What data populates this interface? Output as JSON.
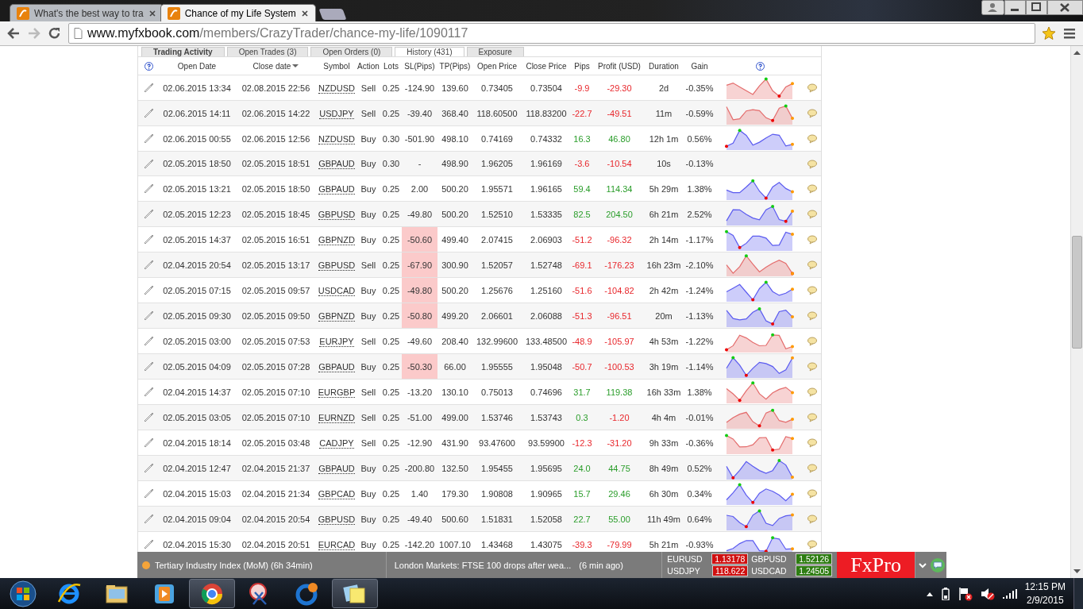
{
  "browser": {
    "tabs": [
      {
        "title": "What's the best way to tra",
        "selected": false
      },
      {
        "title": "Chance of my Life System",
        "selected": true
      }
    ],
    "url": {
      "host": "www.myfxbook.com",
      "path": "/members/CrazyTrader/chance-my-life/1090117"
    }
  },
  "page": {
    "tabs": [
      {
        "label": "Trading Activity",
        "selected": false
      },
      {
        "label": "Open Trades (3)",
        "selected": false
      },
      {
        "label": "Open Orders (0)",
        "selected": false
      },
      {
        "label": "History (431)",
        "selected": true
      },
      {
        "label": "Exposure",
        "selected": false
      }
    ],
    "columns": [
      {
        "label": "Open Date",
        "sorted": false
      },
      {
        "label": "Close date",
        "sorted": true
      },
      {
        "label": "Symbol",
        "sorted": false
      },
      {
        "label": "Action",
        "sorted": false
      },
      {
        "label": "Lots",
        "sorted": false
      },
      {
        "label": "SL(Pips)",
        "sorted": false
      },
      {
        "label": "TP(Pips)",
        "sorted": false
      },
      {
        "label": "Open Price",
        "sorted": false
      },
      {
        "label": "Close Price",
        "sorted": false
      },
      {
        "label": "Pips",
        "sorted": false
      },
      {
        "label": "Profit (USD)",
        "sorted": false
      },
      {
        "label": "Duration",
        "sorted": false
      },
      {
        "label": "Gain",
        "sorted": false
      }
    ],
    "rows": [
      {
        "open": "02.06.2015 13:34",
        "close": "02.08.2015 22:56",
        "symbol": "NZDUSD",
        "action": "Sell",
        "lots": "0.25",
        "sl": "-124.90",
        "tp": "139.60",
        "open_price": "0.73405",
        "close_price": "0.73504",
        "pips": "-9.9",
        "profit": "-29.30",
        "duration": "2d",
        "gain": "-0.35%",
        "sl_highlight": false,
        "pips_up": false,
        "profit_up": false,
        "kind": "sell"
      },
      {
        "open": "02.06.2015 14:11",
        "close": "02.06.2015 14:22",
        "symbol": "USDJPY",
        "action": "Sell",
        "lots": "0.25",
        "sl": "-39.40",
        "tp": "368.40",
        "open_price": "118.60500",
        "close_price": "118.83200",
        "pips": "-22.7",
        "profit": "-49.51",
        "duration": "11m",
        "gain": "-0.59%",
        "sl_highlight": false,
        "pips_up": false,
        "profit_up": false,
        "kind": "sell"
      },
      {
        "open": "02.06.2015 00:55",
        "close": "02.06.2015 12:56",
        "symbol": "NZDUSD",
        "action": "Buy",
        "lots": "0.30",
        "sl": "-501.90",
        "tp": "498.10",
        "open_price": "0.74169",
        "close_price": "0.74332",
        "pips": "16.3",
        "profit": "46.80",
        "duration": "12h 1m",
        "gain": "0.56%",
        "sl_highlight": false,
        "pips_up": true,
        "profit_up": true,
        "kind": "buy"
      },
      {
        "open": "02.05.2015 18:50",
        "close": "02.05.2015 18:51",
        "symbol": "GBPAUD",
        "action": "Buy",
        "lots": "0.30",
        "sl": "-",
        "tp": "498.90",
        "open_price": "1.96205",
        "close_price": "1.96169",
        "pips": "-3.6",
        "profit": "-10.54",
        "duration": "10s",
        "gain": "-0.13%",
        "sl_highlight": false,
        "pips_up": false,
        "profit_up": false,
        "kind": "plain"
      },
      {
        "open": "02.05.2015 13:21",
        "close": "02.05.2015 18:50",
        "symbol": "GBPAUD",
        "action": "Buy",
        "lots": "0.25",
        "sl": "2.00",
        "tp": "500.20",
        "open_price": "1.95571",
        "close_price": "1.96165",
        "pips": "59.4",
        "profit": "114.34",
        "duration": "5h 29m",
        "gain": "1.38%",
        "sl_highlight": false,
        "pips_up": true,
        "profit_up": true,
        "kind": "buy"
      },
      {
        "open": "02.05.2015 12:23",
        "close": "02.05.2015 18:45",
        "symbol": "GBPUSD",
        "action": "Buy",
        "lots": "0.25",
        "sl": "-49.80",
        "tp": "500.20",
        "open_price": "1.52510",
        "close_price": "1.53335",
        "pips": "82.5",
        "profit": "204.50",
        "duration": "6h 21m",
        "gain": "2.52%",
        "sl_highlight": false,
        "pips_up": true,
        "profit_up": true,
        "kind": "buy"
      },
      {
        "open": "02.05.2015 14:37",
        "close": "02.05.2015 16:51",
        "symbol": "GBPNZD",
        "action": "Buy",
        "lots": "0.25",
        "sl": "-50.60",
        "tp": "499.40",
        "open_price": "2.07415",
        "close_price": "2.06903",
        "pips": "-51.2",
        "profit": "-96.32",
        "duration": "2h 14m",
        "gain": "-1.17%",
        "sl_highlight": true,
        "pips_up": false,
        "profit_up": false,
        "kind": "buy"
      },
      {
        "open": "02.04.2015 20:54",
        "close": "02.05.2015 13:17",
        "symbol": "GBPUSD",
        "action": "Sell",
        "lots": "0.25",
        "sl": "-67.90",
        "tp": "300.90",
        "open_price": "1.52057",
        "close_price": "1.52748",
        "pips": "-69.1",
        "profit": "-176.23",
        "duration": "16h 23m",
        "gain": "-2.10%",
        "sl_highlight": true,
        "pips_up": false,
        "profit_up": false,
        "kind": "sell"
      },
      {
        "open": "02.05.2015 07:15",
        "close": "02.05.2015 09:57",
        "symbol": "USDCAD",
        "action": "Buy",
        "lots": "0.25",
        "sl": "-49.80",
        "tp": "500.20",
        "open_price": "1.25676",
        "close_price": "1.25160",
        "pips": "-51.6",
        "profit": "-104.82",
        "duration": "2h 42m",
        "gain": "-1.24%",
        "sl_highlight": true,
        "pips_up": false,
        "profit_up": false,
        "kind": "buy"
      },
      {
        "open": "02.05.2015 09:30",
        "close": "02.05.2015 09:50",
        "symbol": "GBPNZD",
        "action": "Buy",
        "lots": "0.25",
        "sl": "-50.80",
        "tp": "499.20",
        "open_price": "2.06601",
        "close_price": "2.06088",
        "pips": "-51.3",
        "profit": "-96.51",
        "duration": "20m",
        "gain": "-1.13%",
        "sl_highlight": true,
        "pips_up": false,
        "profit_up": false,
        "kind": "buy"
      },
      {
        "open": "02.05.2015 03:00",
        "close": "02.05.2015 07:53",
        "symbol": "EURJPY",
        "action": "Sell",
        "lots": "0.25",
        "sl": "-49.60",
        "tp": "208.40",
        "open_price": "132.99600",
        "close_price": "133.48500",
        "pips": "-48.9",
        "profit": "-105.97",
        "duration": "4h 53m",
        "gain": "-1.22%",
        "sl_highlight": false,
        "pips_up": false,
        "profit_up": false,
        "kind": "sell"
      },
      {
        "open": "02.05.2015 04:09",
        "close": "02.05.2015 07:28",
        "symbol": "GBPAUD",
        "action": "Buy",
        "lots": "0.25",
        "sl": "-50.30",
        "tp": "66.00",
        "open_price": "1.95555",
        "close_price": "1.95048",
        "pips": "-50.7",
        "profit": "-100.53",
        "duration": "3h 19m",
        "gain": "-1.14%",
        "sl_highlight": true,
        "pips_up": false,
        "profit_up": false,
        "kind": "buy"
      },
      {
        "open": "02.04.2015 14:37",
        "close": "02.05.2015 07:10",
        "symbol": "EURGBP",
        "action": "Sell",
        "lots": "0.25",
        "sl": "-13.20",
        "tp": "130.10",
        "open_price": "0.75013",
        "close_price": "0.74696",
        "pips": "31.7",
        "profit": "119.38",
        "duration": "16h 33m",
        "gain": "1.38%",
        "sl_highlight": false,
        "pips_up": true,
        "profit_up": true,
        "kind": "sell"
      },
      {
        "open": "02.05.2015 03:05",
        "close": "02.05.2015 07:10",
        "symbol": "EURNZD",
        "action": "Sell",
        "lots": "0.25",
        "sl": "-51.00",
        "tp": "499.00",
        "open_price": "1.53746",
        "close_price": "1.53743",
        "pips": "0.3",
        "profit": "-1.20",
        "duration": "4h 4m",
        "gain": "-0.01%",
        "sl_highlight": false,
        "pips_up": true,
        "profit_up": false,
        "kind": "sell"
      },
      {
        "open": "02.04.2015 18:14",
        "close": "02.05.2015 03:48",
        "symbol": "CADJPY",
        "action": "Sell",
        "lots": "0.25",
        "sl": "-12.90",
        "tp": "431.90",
        "open_price": "93.47600",
        "close_price": "93.59900",
        "pips": "-12.3",
        "profit": "-31.20",
        "duration": "9h 33m",
        "gain": "-0.36%",
        "sl_highlight": false,
        "pips_up": false,
        "profit_up": false,
        "kind": "sell"
      },
      {
        "open": "02.04.2015 12:47",
        "close": "02.04.2015 21:37",
        "symbol": "GBPAUD",
        "action": "Buy",
        "lots": "0.25",
        "sl": "-200.80",
        "tp": "132.50",
        "open_price": "1.95455",
        "close_price": "1.95695",
        "pips": "24.0",
        "profit": "44.75",
        "duration": "8h 49m",
        "gain": "0.52%",
        "sl_highlight": false,
        "pips_up": true,
        "profit_up": true,
        "kind": "buy"
      },
      {
        "open": "02.04.2015 15:03",
        "close": "02.04.2015 21:34",
        "symbol": "GBPCAD",
        "action": "Buy",
        "lots": "0.25",
        "sl": "1.40",
        "tp": "179.30",
        "open_price": "1.90808",
        "close_price": "1.90965",
        "pips": "15.7",
        "profit": "29.46",
        "duration": "6h 30m",
        "gain": "0.34%",
        "sl_highlight": false,
        "pips_up": true,
        "profit_up": true,
        "kind": "buy"
      },
      {
        "open": "02.04.2015 09:04",
        "close": "02.04.2015 20:54",
        "symbol": "GBPUSD",
        "action": "Buy",
        "lots": "0.25",
        "sl": "-49.40",
        "tp": "500.60",
        "open_price": "1.51831",
        "close_price": "1.52058",
        "pips": "22.7",
        "profit": "55.00",
        "duration": "11h 49m",
        "gain": "0.64%",
        "sl_highlight": false,
        "pips_up": true,
        "profit_up": true,
        "kind": "buy"
      },
      {
        "open": "02.04.2015 15:30",
        "close": "02.04.2015 20:51",
        "symbol": "EURCAD",
        "action": "Buy",
        "lots": "0.25",
        "sl": "-142.20",
        "tp": "1007.10",
        "open_price": "1.43468",
        "close_price": "1.43075",
        "pips": "-39.3",
        "profit": "-79.99",
        "duration": "5h 21m",
        "gain": "-0.93%",
        "sl_highlight": false,
        "pips_up": false,
        "profit_up": false,
        "kind": "buy"
      }
    ]
  },
  "ticker": {
    "event": "Tertiary Industry Index (MoM) (6h 34min)",
    "headline": "London Markets: FTSE 100 drops after wea...",
    "age": "(6 min ago)",
    "quotes": [
      {
        "symbol": "EURUSD",
        "price": "1.13178",
        "up": false
      },
      {
        "symbol": "USDJPY",
        "price": "118.622",
        "up": false
      },
      {
        "symbol": "GBPUSD",
        "price": "1.52126",
        "up": true
      },
      {
        "symbol": "USDCAD",
        "price": "1.24505",
        "up": true
      }
    ],
    "logo": "FxPro"
  },
  "taskbar": {
    "apps": [
      {
        "kind": "ie",
        "selected": false
      },
      {
        "kind": "explorer",
        "selected": false
      },
      {
        "kind": "media",
        "selected": false
      },
      {
        "kind": "chrome",
        "selected": true
      },
      {
        "kind": "snipping",
        "selected": false
      },
      {
        "kind": "cleaner",
        "selected": false
      },
      {
        "kind": "notes",
        "selected": true
      }
    ],
    "time": "12:15 PM",
    "date": "2/9/2015"
  }
}
